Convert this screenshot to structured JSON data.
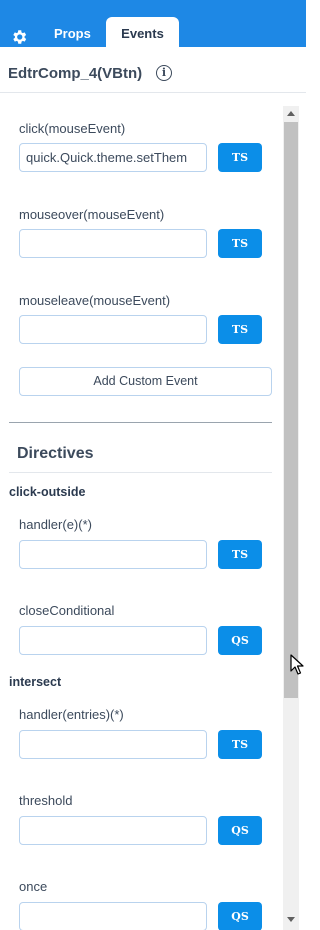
{
  "tabs": {
    "props": "Props",
    "events": "Events"
  },
  "component": {
    "title": "EdtrComp_4(VBtn)",
    "info_glyph": "i"
  },
  "events": [
    {
      "label": "click(mouseEvent)",
      "value": "quick.Quick.theme.setThem",
      "button": "TS"
    },
    {
      "label": "mouseover(mouseEvent)",
      "value": "",
      "button": "TS"
    },
    {
      "label": "mouseleave(mouseEvent)",
      "value": "",
      "button": "TS"
    }
  ],
  "add_custom_event": "Add Custom Event",
  "directives": {
    "heading": "Directives",
    "click_outside": {
      "name": "click-outside",
      "fields": [
        {
          "label": "handler(e)(*)",
          "value": "",
          "button": "TS"
        },
        {
          "label": "closeConditional",
          "value": "",
          "button": "QS"
        }
      ]
    },
    "intersect": {
      "name": "intersect",
      "fields": [
        {
          "label": "handler(entries)(*)",
          "value": "",
          "button": "TS"
        },
        {
          "label": "threshold",
          "value": "",
          "button": "QS"
        },
        {
          "label": "once",
          "value": "",
          "button": "QS"
        }
      ]
    }
  },
  "colors": {
    "accent": "#1e88e5",
    "button": "#0b8ee8",
    "text": "#3c4a5c",
    "input_border": "#b9d3ee"
  }
}
